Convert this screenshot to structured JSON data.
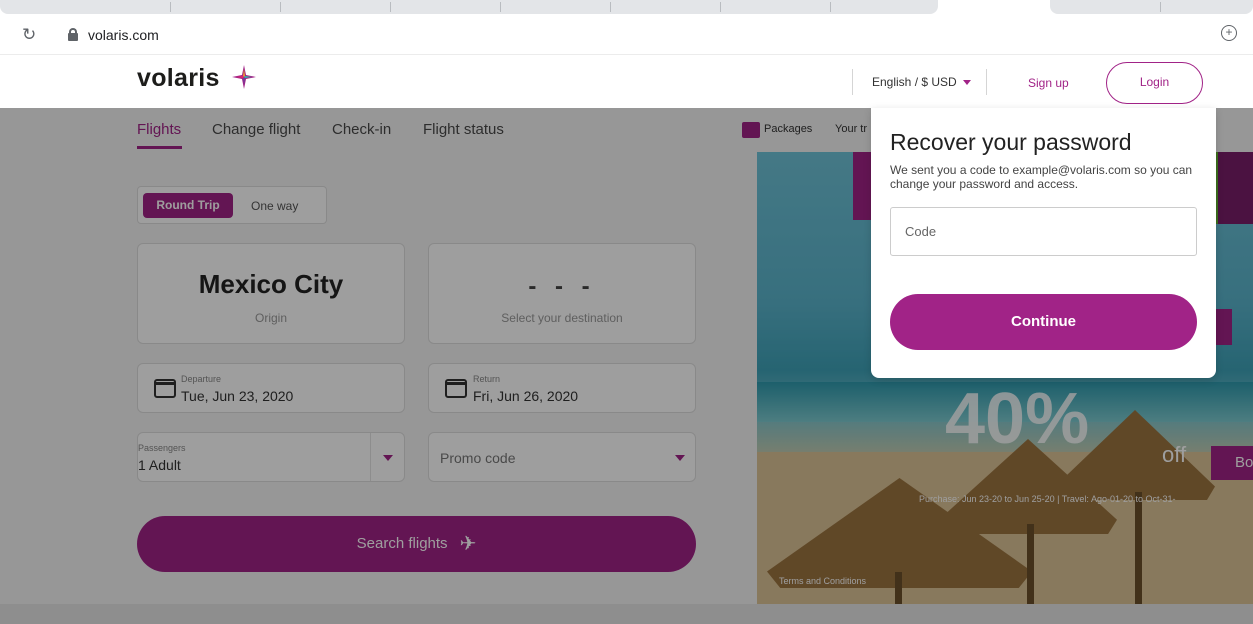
{
  "browser": {
    "url": "volaris.com",
    "reload_icon": "reload-icon",
    "lock_icon": "lock-icon",
    "zoom_icon": "zoom-icon"
  },
  "header": {
    "logo_text": "volaris",
    "language": "English / $ USD",
    "signup": "Sign up",
    "login": "Login"
  },
  "nav": {
    "items": [
      "Flights",
      "Change flight",
      "Check-in",
      "Flight status"
    ],
    "packages": "Packages",
    "your_trip": "Your tr"
  },
  "booking": {
    "trip_types": [
      "Round Trip",
      "One way"
    ],
    "origin_city": "Mexico City",
    "origin_label": "Origin",
    "destination_value": "- - -",
    "destination_label": "Select your destination",
    "departure_label": "Departure",
    "departure_value": "Tue, Jun 23, 2020",
    "return_label": "Return",
    "return_value": "Fri, Jun 26, 2020",
    "passengers_label": "Passengers",
    "passengers_value": "1 Adult",
    "promo_placeholder": "Promo code",
    "search_label": "Search flights"
  },
  "promo": {
    "big_text": "40%",
    "off_text": "off",
    "book_text": "Bo",
    "dates": "Purchase: Jun 23-20 to Jun 25-20 | Travel: Ago-01-20 to Oct-31-",
    "terms": "Terms and Conditions"
  },
  "modal": {
    "title": "Recover your password",
    "description": "We sent you a code to example@volaris.com so you can change your password and access.",
    "code_placeholder": "Code",
    "continue_label": "Continue"
  },
  "colors": {
    "brand": "#a12387",
    "overlay": "rgba(0,0,0,0.38)"
  }
}
